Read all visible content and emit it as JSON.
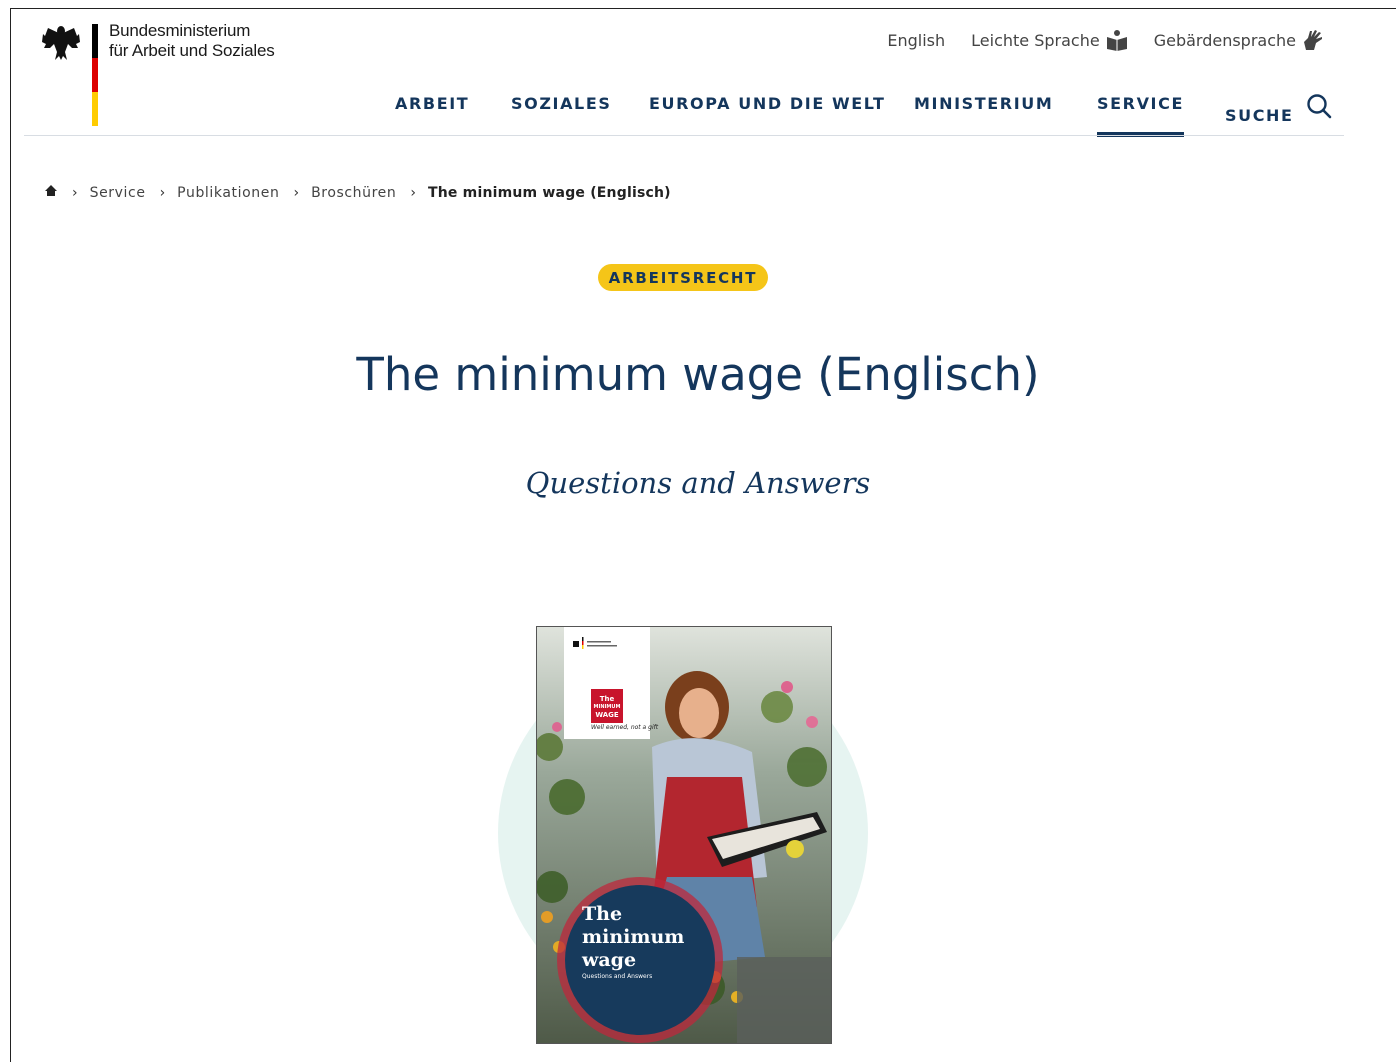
{
  "header": {
    "ministry_line1": "Bundesministerium",
    "ministry_line2": "für Arbeit und Soziales",
    "service_links": [
      {
        "label": "English",
        "icon": ""
      },
      {
        "label": "Leichte Sprache",
        "icon": "easy-read-book-icon"
      },
      {
        "label": "Gebärdensprache",
        "icon": "sign-language-hands-icon"
      }
    ],
    "nav": [
      {
        "label": "ARBEIT",
        "active": false
      },
      {
        "label": "SOZIALES",
        "active": false
      },
      {
        "label": "EUROPA UND DIE WELT",
        "active": false
      },
      {
        "label": "MINISTERIUM",
        "active": false
      },
      {
        "label": "SERVICE",
        "active": true
      },
      {
        "label": "SUCHE",
        "active": false,
        "icon": "search-icon"
      }
    ]
  },
  "breadcrumb": {
    "home_icon": "home-icon",
    "items": [
      "Service",
      "Publikationen",
      "Broschüren",
      "The minimum wage (Englisch)"
    ]
  },
  "content": {
    "topic": "ARBEITSRECHT",
    "title": "The minimum wage (Englisch)",
    "subtitle": "Questions and Answers"
  },
  "cover": {
    "badge_lines": [
      "The",
      "MINIMUM",
      "WAGE"
    ],
    "badge_tagline": "Well earned, not a gift",
    "title_lines": [
      "The",
      "minimum",
      "wage"
    ],
    "title_sub": "Questions and Answers"
  },
  "colors": {
    "brand_blue": "#14365c",
    "badge_yellow": "#f5c518",
    "flag_black": "#000000",
    "flag_red": "#dd0000",
    "flag_gold": "#ffcc00"
  }
}
